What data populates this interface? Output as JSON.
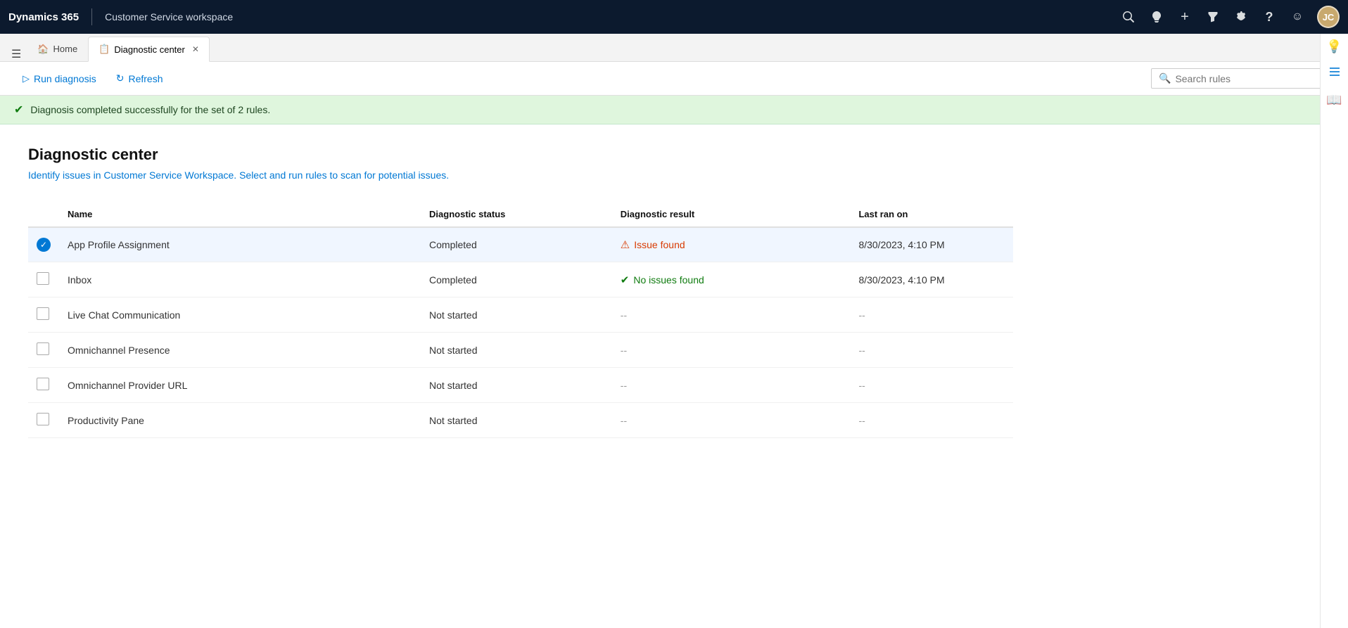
{
  "topNav": {
    "brand": "Dynamics 365",
    "appName": "Customer Service workspace",
    "avatarInitials": "JC"
  },
  "tabs": [
    {
      "id": "home",
      "label": "Home",
      "icon": "🏠",
      "active": false,
      "closeable": false
    },
    {
      "id": "diagnostic",
      "label": "Diagnostic center",
      "icon": "📋",
      "active": true,
      "closeable": true
    }
  ],
  "toolbar": {
    "runDiagnosisLabel": "Run diagnosis",
    "refreshLabel": "Refresh",
    "searchPlaceholder": "Search rules"
  },
  "banner": {
    "message": "Diagnosis completed successfully for the set of 2 rules."
  },
  "page": {
    "title": "Diagnostic center",
    "subtitle": "Identify issues in Customer Service Workspace. Select and run rules to scan for potential issues."
  },
  "table": {
    "columns": [
      {
        "id": "checkbox",
        "label": ""
      },
      {
        "id": "name",
        "label": "Name"
      },
      {
        "id": "status",
        "label": "Diagnostic status"
      },
      {
        "id": "result",
        "label": "Diagnostic result"
      },
      {
        "id": "lastRan",
        "label": "Last ran on"
      }
    ],
    "rows": [
      {
        "id": 1,
        "checked": true,
        "name": "App Profile Assignment",
        "status": "Completed",
        "resultType": "issue",
        "resultLabel": "Issue found",
        "lastRan": "8/30/2023, 4:10 PM",
        "selected": true
      },
      {
        "id": 2,
        "checked": false,
        "name": "Inbox",
        "status": "Completed",
        "resultType": "ok",
        "resultLabel": "No issues found",
        "lastRan": "8/30/2023, 4:10 PM",
        "selected": false
      },
      {
        "id": 3,
        "checked": false,
        "name": "Live Chat Communication",
        "status": "Not started",
        "resultType": "none",
        "resultLabel": "--",
        "lastRan": "--",
        "selected": false
      },
      {
        "id": 4,
        "checked": false,
        "name": "Omnichannel Presence",
        "status": "Not started",
        "resultType": "none",
        "resultLabel": "--",
        "lastRan": "--",
        "selected": false
      },
      {
        "id": 5,
        "checked": false,
        "name": "Omnichannel Provider URL",
        "status": "Not started",
        "resultType": "none",
        "resultLabel": "--",
        "lastRan": "--",
        "selected": false
      },
      {
        "id": 6,
        "checked": false,
        "name": "Productivity Pane",
        "status": "Not started",
        "resultType": "none",
        "resultLabel": "--",
        "lastRan": "--",
        "selected": false
      }
    ]
  }
}
